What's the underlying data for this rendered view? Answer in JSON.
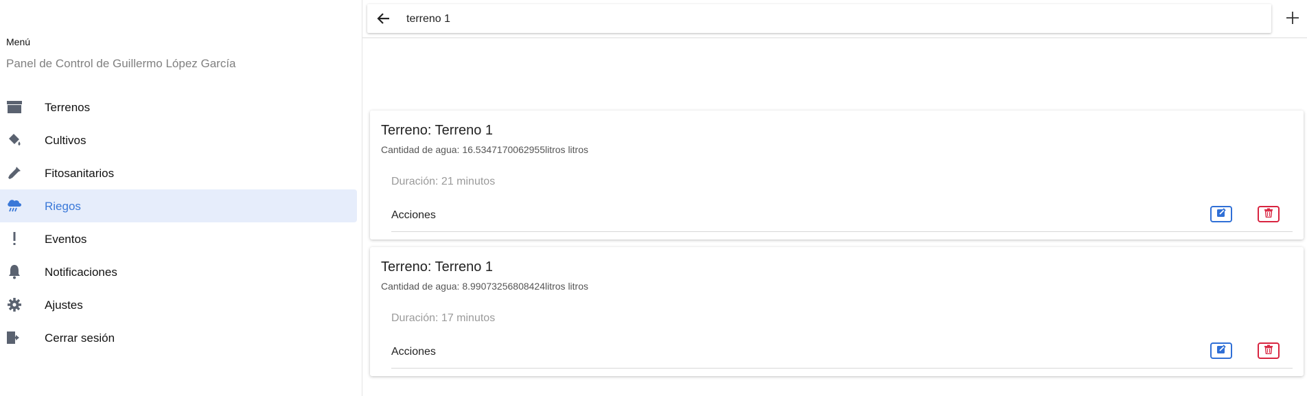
{
  "sidebar": {
    "title": "Menú",
    "subtitle": "Panel de Control de Guillermo López García",
    "items": [
      {
        "label": "Terrenos",
        "icon": "archive-icon",
        "active": false
      },
      {
        "label": "Cultivos",
        "icon": "paint-bucket-icon",
        "active": false
      },
      {
        "label": "Fitosanitarios",
        "icon": "eyedropper-icon",
        "active": false
      },
      {
        "label": "Riegos",
        "icon": "cloud-rain-icon",
        "active": true
      },
      {
        "label": "Eventos",
        "icon": "exclamation-icon",
        "active": false
      },
      {
        "label": "Notificaciones",
        "icon": "bell-icon",
        "active": false
      },
      {
        "label": "Ajustes",
        "icon": "gear-icon",
        "active": false
      },
      {
        "label": "Cerrar sesión",
        "icon": "sign-out-icon",
        "active": false
      }
    ]
  },
  "topbar": {
    "search_value": "terreno 1",
    "back_icon": "arrow-left-icon",
    "add_icon": "plus-icon"
  },
  "cards": [
    {
      "title": "Terreno: Terreno 1",
      "water": "Cantidad de agua: 16.5347170062955litros litros",
      "duration": "Duración: 21 minutos",
      "actions_label": "Acciones"
    },
    {
      "title": "Terreno: Terreno 1",
      "water": "Cantidad de agua: 8.99073256808424litros litros",
      "duration": "Duración: 17 minutos",
      "actions_label": "Acciones"
    }
  ],
  "colors": {
    "accent": "#3a78d8",
    "active_bg": "#e6edfb",
    "edit": "#2f6fd6",
    "delete": "#d8233f",
    "icon": "#5a6270"
  }
}
